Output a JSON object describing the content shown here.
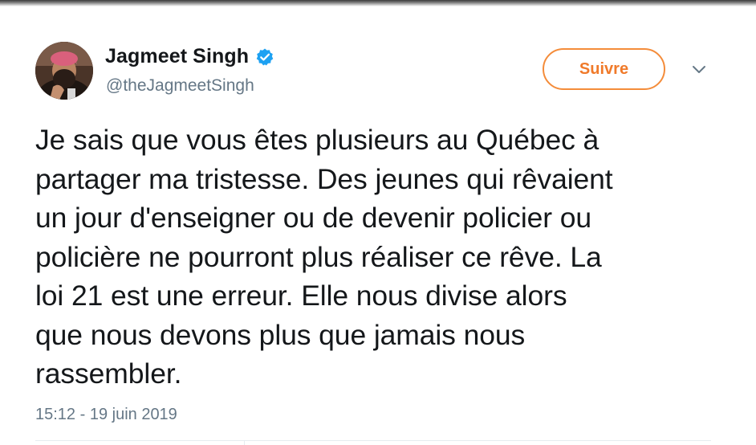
{
  "author": {
    "display_name": "Jagmeet Singh",
    "handle": "@theJagmeetSingh",
    "verified": true
  },
  "actions": {
    "follow_label": "Suivre"
  },
  "tweet": {
    "text": "Je sais que vous êtes plusieurs au Québec à\npartager ma tristesse. Des jeunes qui rêvaient\nun jour d'enseigner ou de devenir policier ou\npolicière ne pourront plus réaliser ce rêve. La\nloi 21 est une erreur. Elle nous divise alors\nque nous devons plus que jamais nous\nrassembler.",
    "timestamp": "15:12 - 19 juin 2019"
  },
  "icons": {
    "verified": "verified-badge-icon",
    "menu": "chevron-down-icon"
  },
  "colors": {
    "follow_accent": "#f07a2a",
    "verified_blue": "#1da1f2",
    "secondary_text": "#657786",
    "primary_text": "#14171a"
  }
}
